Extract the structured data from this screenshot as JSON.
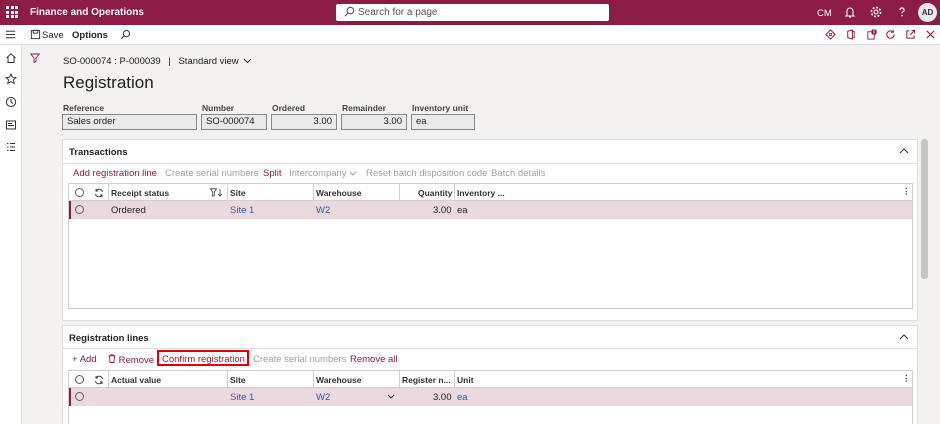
{
  "topbar": {
    "app_title": "Finance and Operations",
    "search_placeholder": "Search for a page",
    "company": "CM",
    "user_initials": "AD"
  },
  "actionbar": {
    "save_label": "Save",
    "options_label": "Options"
  },
  "breadcrumb": {
    "record": "SO-000074 : P-000039",
    "separator": "|",
    "view": "Standard view"
  },
  "page_title": "Registration",
  "header_fields": [
    {
      "label": "Reference",
      "value": "Sales order"
    },
    {
      "label": "Number",
      "value": "SO-000074"
    },
    {
      "label": "Ordered",
      "value": "3.00"
    },
    {
      "label": "Remainder",
      "value": "3.00"
    },
    {
      "label": "Inventory unit",
      "value": "ea"
    }
  ],
  "transactions": {
    "title": "Transactions",
    "buttons": {
      "add_registration_line": "Add registration line",
      "create_serial_numbers": "Create serial numbers",
      "split": "Split",
      "intercompany": "Intercompany",
      "reset_batch": "Reset batch disposition code",
      "batch_details": "Batch details"
    },
    "columns": {
      "receipt_status": "Receipt status",
      "site": "Site",
      "warehouse": "Warehouse",
      "quantity": "Quantity",
      "inventory": "Inventory ..."
    },
    "rows": [
      {
        "receipt_status": "Ordered",
        "site": "Site 1",
        "warehouse": "W2",
        "quantity": "3.00",
        "inventory": "ea"
      }
    ]
  },
  "registration_lines": {
    "title": "Registration lines",
    "buttons": {
      "add": "Add",
      "remove": "Remove",
      "confirm_registration": "Confirm registration",
      "create_serial_numbers": "Create serial numbers",
      "remove_all": "Remove all"
    },
    "columns": {
      "actual_value": "Actual value",
      "site": "Site",
      "warehouse": "Warehouse",
      "register_n": "Register n...",
      "unit": "Unit"
    },
    "rows": [
      {
        "actual_value": "",
        "site": "Site 1",
        "warehouse": "W2",
        "register_n": "3.00",
        "unit": "ea"
      }
    ]
  },
  "colors": {
    "brand": "#8c1b45",
    "link": "#2f5fa5",
    "selected_row": "#ecd9e0",
    "highlight": "#e00000"
  }
}
